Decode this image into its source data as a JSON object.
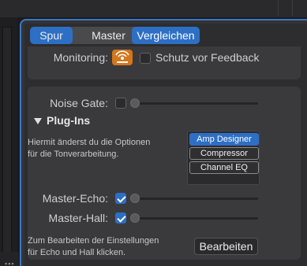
{
  "tabs": {
    "track": "Spur",
    "master": "Master"
  },
  "compare_label": "Vergleichen",
  "monitoring": {
    "label": "Monitoring:",
    "feedback_label": "Schutz vor Feedback",
    "feedback_checked": false
  },
  "noise_gate": {
    "label": "Noise Gate:",
    "checked": false,
    "level": 0
  },
  "plugins": {
    "header": "Plug-Ins",
    "description_line1": "Hiermit änderst du die Optionen",
    "description_line2": "für die Tonverarbeitung.",
    "items": [
      "Amp Designer",
      "Compressor",
      "Channel EQ"
    ],
    "selected": "Amp Designer"
  },
  "master_echo": {
    "label": "Master-Echo:",
    "checked": true,
    "level": 0
  },
  "master_hall": {
    "label": "Master-Hall:",
    "checked": true,
    "level": 0
  },
  "edit": {
    "hint_line1": "Zum Bearbeiten der Einstellungen",
    "hint_line2": "für Echo und Hall klicken.",
    "button_label": "Bearbeiten"
  },
  "colors": {
    "accent": "#2d6fc5",
    "monitor_icon": "#d4761c",
    "panel": "#333335"
  }
}
